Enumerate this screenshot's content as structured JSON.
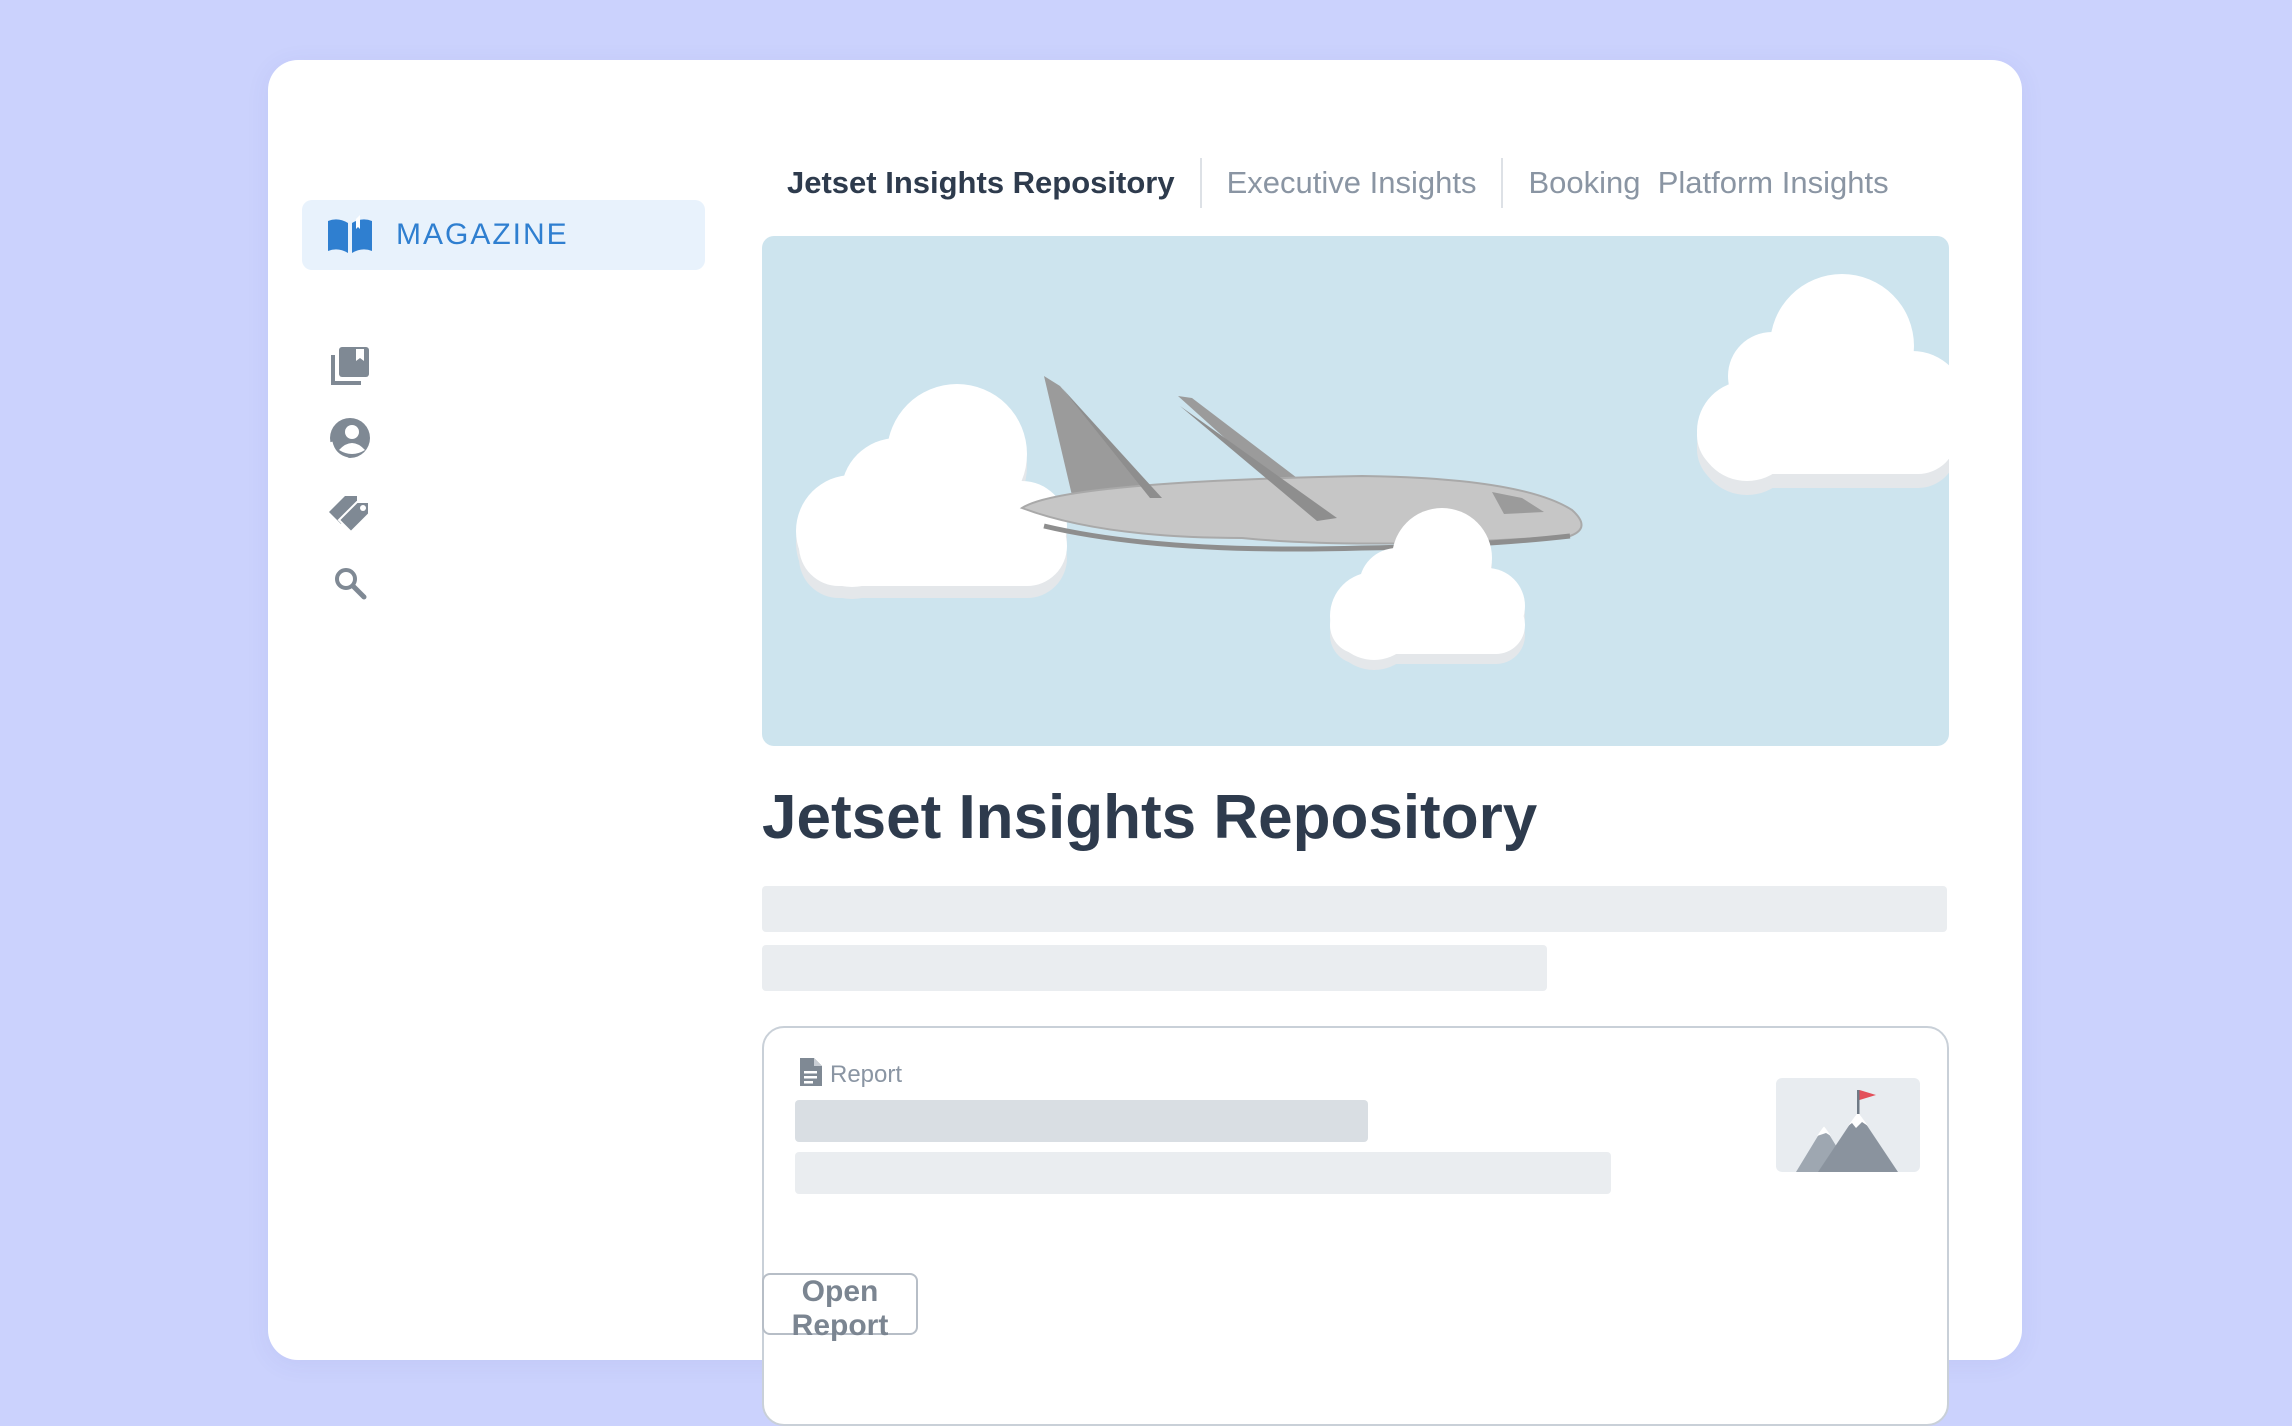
{
  "sidebar": {
    "items": [
      {
        "icon": "home-icon",
        "label": ""
      },
      {
        "icon": "open-book-icon",
        "label": "MAGAZINE",
        "active": true
      },
      {
        "icon": "library-icon",
        "label": ""
      },
      {
        "icon": "user-icon",
        "label": ""
      },
      {
        "icon": "tags-icon",
        "label": ""
      },
      {
        "icon": "search-icon",
        "label": ""
      }
    ]
  },
  "tabs": [
    {
      "label": "Jetset Insights Repository",
      "active": true
    },
    {
      "label": "Executive Insights",
      "active": false
    },
    {
      "label": "Booking  Platform Insights",
      "active": false
    }
  ],
  "page": {
    "title": "Jetset Insights Repository"
  },
  "report_card": {
    "type_label": "Report",
    "type_icon": "document-icon",
    "thumbnail_icon": "mountain-flag-icon",
    "open_button_label": "Open Report"
  },
  "colors": {
    "background": "#cbd2fd",
    "accent": "#2f7fd0",
    "active_nav_bg": "#e8f2fc",
    "title_text": "#2e3b4d",
    "muted_text": "#8a95a3",
    "hero_sky": "#cde4ee"
  }
}
